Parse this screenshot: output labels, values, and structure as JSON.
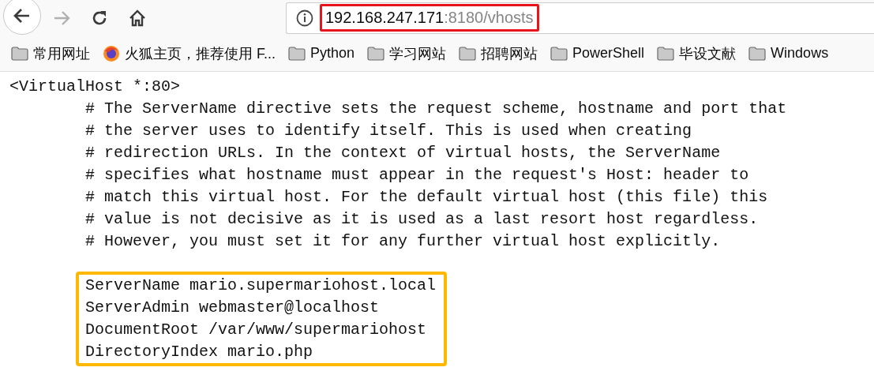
{
  "toolbar": {
    "back_disabled": false,
    "forward_disabled": true
  },
  "address_bar": {
    "host": "192.168.247.171",
    "rest": ":8180/vhosts",
    "highlighted": true
  },
  "bookmarks": [
    {
      "kind": "folder",
      "label": "常用网址"
    },
    {
      "kind": "browser",
      "label": "火狐主页，推荐使用 F..."
    },
    {
      "kind": "folder",
      "label": "Python"
    },
    {
      "kind": "folder",
      "label": "学习网站"
    },
    {
      "kind": "folder",
      "label": "招聘网站"
    },
    {
      "kind": "folder",
      "label": "PowerShell"
    },
    {
      "kind": "folder",
      "label": "毕设文献"
    },
    {
      "kind": "folder",
      "label": "Windows"
    }
  ],
  "document": {
    "open_tag": "<VirtualHost *:80>",
    "comments": [
      "# The ServerName directive sets the request scheme, hostname and port that",
      "# the server uses to identify itself. This is used when creating",
      "# redirection URLs. In the context of virtual hosts, the ServerName",
      "# specifies what hostname must appear in the request's Host: header to",
      "# match this virtual host. For the default virtual host (this file) this",
      "# value is not decisive as it is used as a last resort host regardless.",
      "# However, you must set it for any further virtual host explicitly."
    ],
    "directives_highlighted": true,
    "directives": [
      "ServerName mario.supermariohost.local",
      "ServerAdmin webmaster@localhost",
      "DocumentRoot /var/www/supermariohost",
      "DirectoryIndex mario.php"
    ]
  }
}
